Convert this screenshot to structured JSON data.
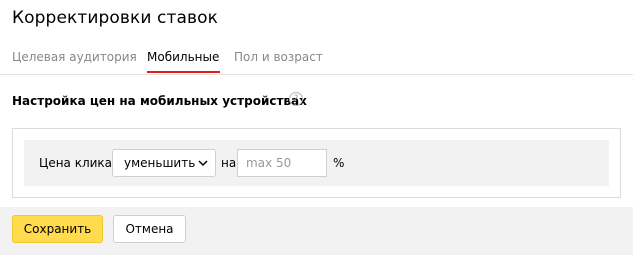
{
  "page": {
    "title": "Корректировки ставок"
  },
  "tabs": [
    {
      "label": "Целевая аудитория"
    },
    {
      "label": "Мобильные"
    },
    {
      "label": "Пол и возраст"
    }
  ],
  "active_tab": "Мобильные",
  "colors": {
    "active_tab_underline": "#e02020",
    "primary_button": "#ffdb4d",
    "footer_bg": "#f2f2f2",
    "row_bg": "#f2f2f2"
  },
  "section": {
    "title": "Настройка цен на мобильных устройствах",
    "help_icon": "question-icon",
    "help_glyph": "?"
  },
  "bid_row": {
    "label": "Цена клика",
    "action_select": {
      "value": "уменьшить",
      "icon": "chevron-down-icon"
    },
    "preposition": "на",
    "amount_input": {
      "value": "",
      "placeholder": "max 50"
    },
    "unit": "%"
  },
  "footer": {
    "save_label": "Сохранить",
    "cancel_label": "Отмена"
  }
}
